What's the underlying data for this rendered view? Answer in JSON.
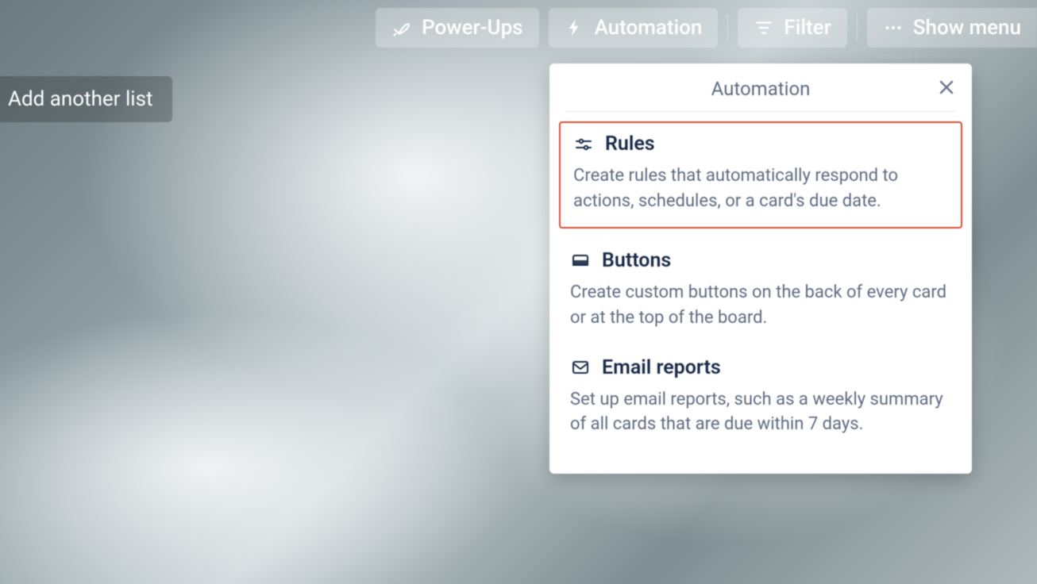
{
  "toolbar": {
    "power_ups": "Power-Ups",
    "automation": "Automation",
    "filter": "Filter",
    "show_menu": "Show menu"
  },
  "add_list_label": "Add another list",
  "panel": {
    "title": "Automation",
    "items": [
      {
        "title": "Rules",
        "description": "Create rules that automatically respond to actions, schedules, or a card's due date.",
        "highlighted": true
      },
      {
        "title": "Buttons",
        "description": "Create custom buttons on the back of every card or at the top of the board.",
        "highlighted": false
      },
      {
        "title": "Email reports",
        "description": "Set up email reports, such as a weekly summary of all cards that are due within 7 days.",
        "highlighted": false
      }
    ]
  }
}
